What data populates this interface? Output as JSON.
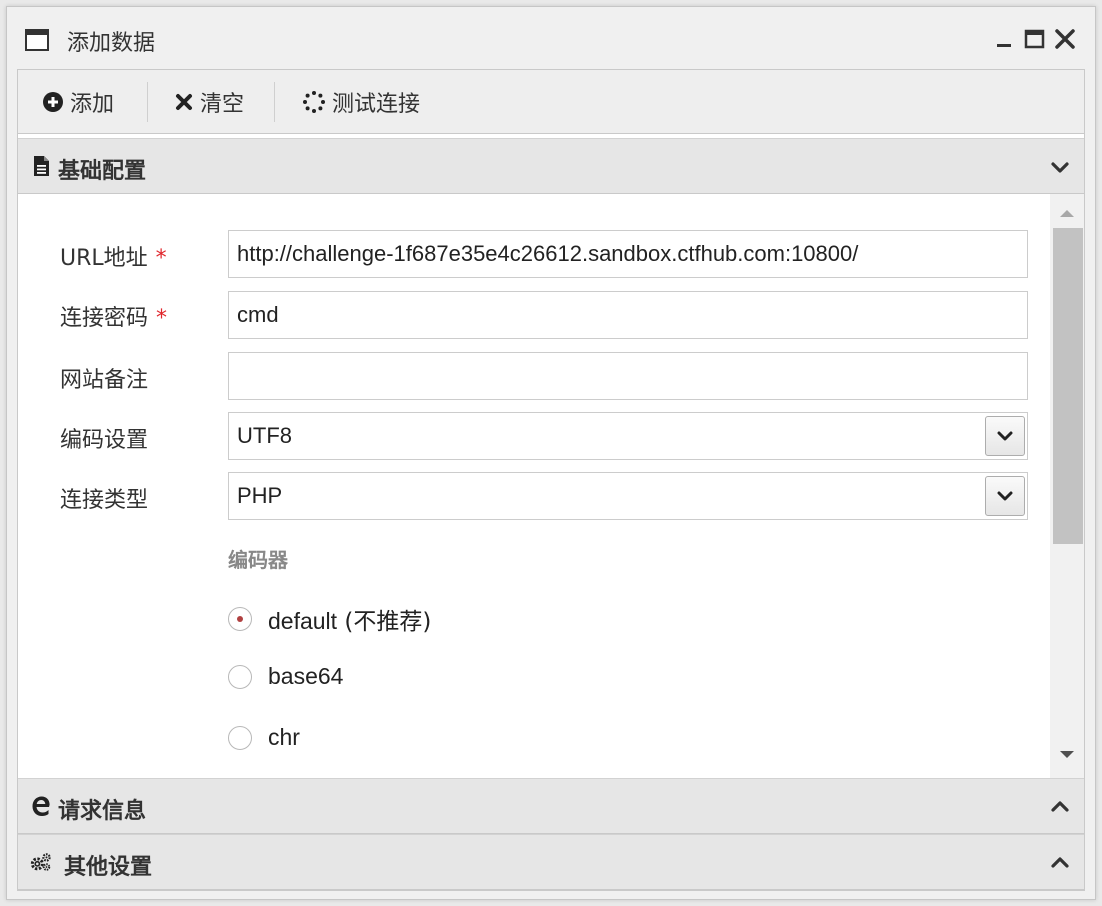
{
  "window": {
    "title": "添加数据"
  },
  "toolbar": {
    "add_label": "添加",
    "clear_label": "清空",
    "test_label": "测试连接"
  },
  "panels": {
    "basic": "基础配置",
    "request": "请求信息",
    "other": "其他设置"
  },
  "form": {
    "url_label": "URL地址",
    "url_value": "http://challenge-1f687e35e4c26612.sandbox.ctfhub.com:10800/",
    "password_label": "连接密码",
    "password_value": "cmd",
    "note_label": "网站备注",
    "note_value": "",
    "encoding_label": "编码设置",
    "encoding_value": "UTF8",
    "type_label": "连接类型",
    "type_value": "PHP",
    "required_mark": "*",
    "encoder_title": "编码器",
    "encoders": [
      {
        "label": "default",
        "suffix": " (不推荐)",
        "checked": true
      },
      {
        "label": "base64",
        "suffix": "",
        "checked": false
      },
      {
        "label": "chr",
        "suffix": "",
        "checked": false
      }
    ]
  },
  "colors": {
    "required": "#e0262c",
    "header_bg": "#e6e6e6",
    "toolbar_bg": "#eeeeee"
  }
}
